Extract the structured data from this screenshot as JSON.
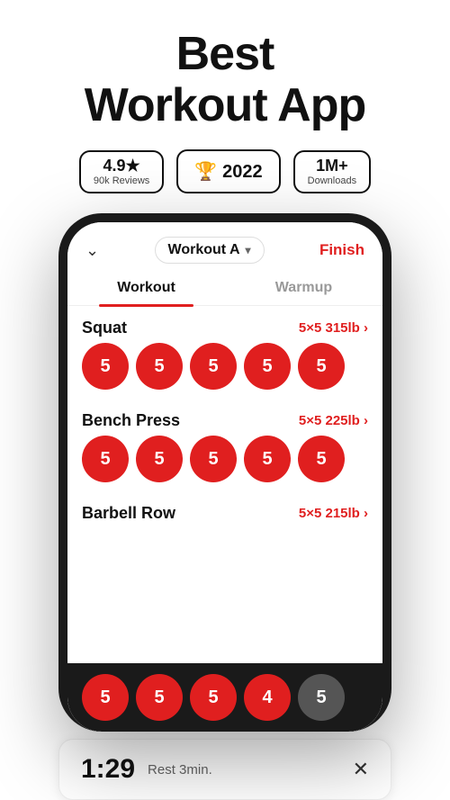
{
  "hero": {
    "title_line1": "Best",
    "title_line2": "Workout App"
  },
  "badges": {
    "rating": {
      "main": "4.9★",
      "sub": "90k Reviews"
    },
    "award": {
      "icon": "🏆",
      "year": "2022"
    },
    "downloads": {
      "main": "1M+",
      "sub": "Downloads"
    }
  },
  "phone": {
    "topbar": {
      "chevron": "›",
      "workout_name": "Workout A",
      "finish_label": "Finish"
    },
    "tabs": [
      {
        "label": "Workout",
        "active": true
      },
      {
        "label": "Warmup",
        "active": false
      }
    ],
    "exercises": [
      {
        "name": "Squat",
        "sets_label": "5×5 315lb ›",
        "sets": [
          5,
          5,
          5,
          5,
          5
        ],
        "all_complete": true
      },
      {
        "name": "Bench Press",
        "sets_label": "5×5 225lb ›",
        "sets": [
          5,
          5,
          5,
          5,
          5
        ],
        "all_complete": true
      },
      {
        "name": "Barbell Row",
        "sets_label": "5×5 215lb ›",
        "sets": [
          5,
          5,
          5,
          4,
          5
        ],
        "incomplete_index": 4
      }
    ],
    "bottom_sets": [
      5,
      5,
      5,
      4,
      5
    ],
    "bottom_incomplete_index": 4
  },
  "rest_timer": {
    "time": "1:29",
    "label": "Rest 3min.",
    "close_icon": "✕"
  }
}
